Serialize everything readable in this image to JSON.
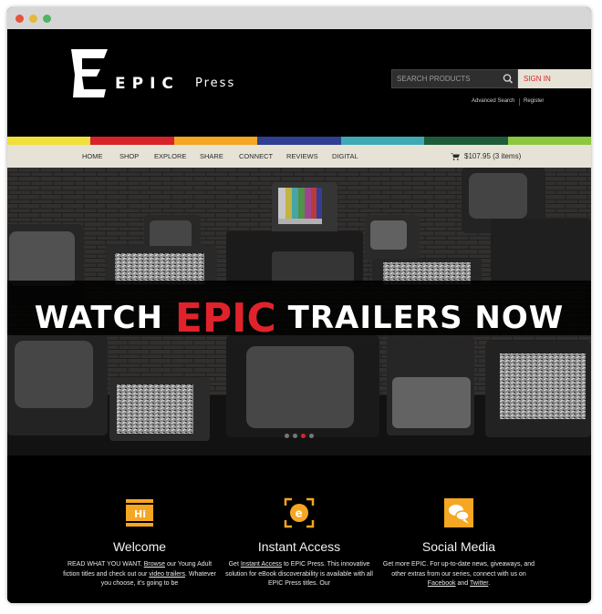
{
  "header": {
    "logo_wordmark": "EPIC",
    "logo_press": "Press",
    "search_placeholder": "SEARCH PRODUCTS",
    "signin_label": "SIGN IN",
    "advanced_search_label": "Advanced Search",
    "register_label": "Register"
  },
  "stripe_colors": [
    "#f0e03a",
    "#d8232a",
    "#f5a623",
    "#2f3f93",
    "#3fa9b5",
    "#1f5d3a",
    "#8dc63f"
  ],
  "nav": {
    "items": [
      {
        "label": "HOME"
      },
      {
        "label": "SHOP"
      },
      {
        "label": "EXPLORE"
      },
      {
        "label": "SHARE"
      },
      {
        "label": "CONNECT"
      },
      {
        "label": "REVIEWS"
      },
      {
        "label": "DIGITAL"
      }
    ],
    "cart_summary": "$107.95 (3 items)"
  },
  "hero": {
    "headline_before": "WATCH",
    "headline_highlight": "EPIC",
    "headline_after": "TRAILERS NOW",
    "carousel_active_index": 2,
    "carousel_count": 4
  },
  "features": [
    {
      "icon": "hi-icon",
      "icon_text": "Hi",
      "title": "Welcome",
      "text_1": "READ WHAT YOU WANT.",
      "link_1": "Browse",
      "text_2": "our Young Adult fiction titles and check out our",
      "link_2": "video trailers",
      "text_3": ". Whatever you choose, it's going to be"
    },
    {
      "icon": "e-access-icon",
      "icon_text": "e",
      "title": "Instant Access",
      "text_1": "Get",
      "link_1": "Instant Access",
      "text_2": "to EPIC Press. This innovative solution for eBook discoverability is available with all EPIC Press titles. Our"
    },
    {
      "icon": "speech-bubble-icon",
      "title": "Social Media",
      "text_1": "Get more EPIC. For up-to-date news, giveaways, and other extras from our series, connect with us on",
      "link_1": "Facebook",
      "text_2": "and",
      "link_2": "Twitter",
      "text_3": "."
    }
  ],
  "colors": {
    "accent_red": "#d8232a",
    "icon_orange": "#f5a623",
    "nav_bg": "#e6e2d6"
  }
}
